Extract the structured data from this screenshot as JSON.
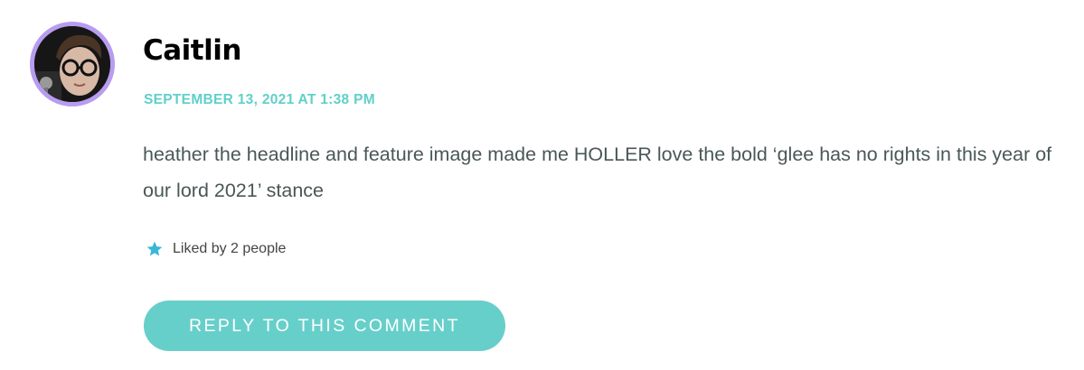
{
  "comment": {
    "author": "Caitlin",
    "timestamp": "SEPTEMBER 13, 2021 AT 1:38 PM",
    "body": "heather the headline and feature image made me HOLLER love the bold ‘glee has no rights in this year of our lord 2021’ stance",
    "likes_text": "Liked by 2 people",
    "reply_label": "REPLY TO THIS COMMENT"
  },
  "colors": {
    "accent": "#67cfca",
    "timestamp": "#5fd0c9",
    "avatar_ring": "#b89cf0",
    "body_text": "#4a5757",
    "star": "#3ab7d8"
  },
  "icons": {
    "avatar": "user-photo",
    "like": "star-icon"
  }
}
